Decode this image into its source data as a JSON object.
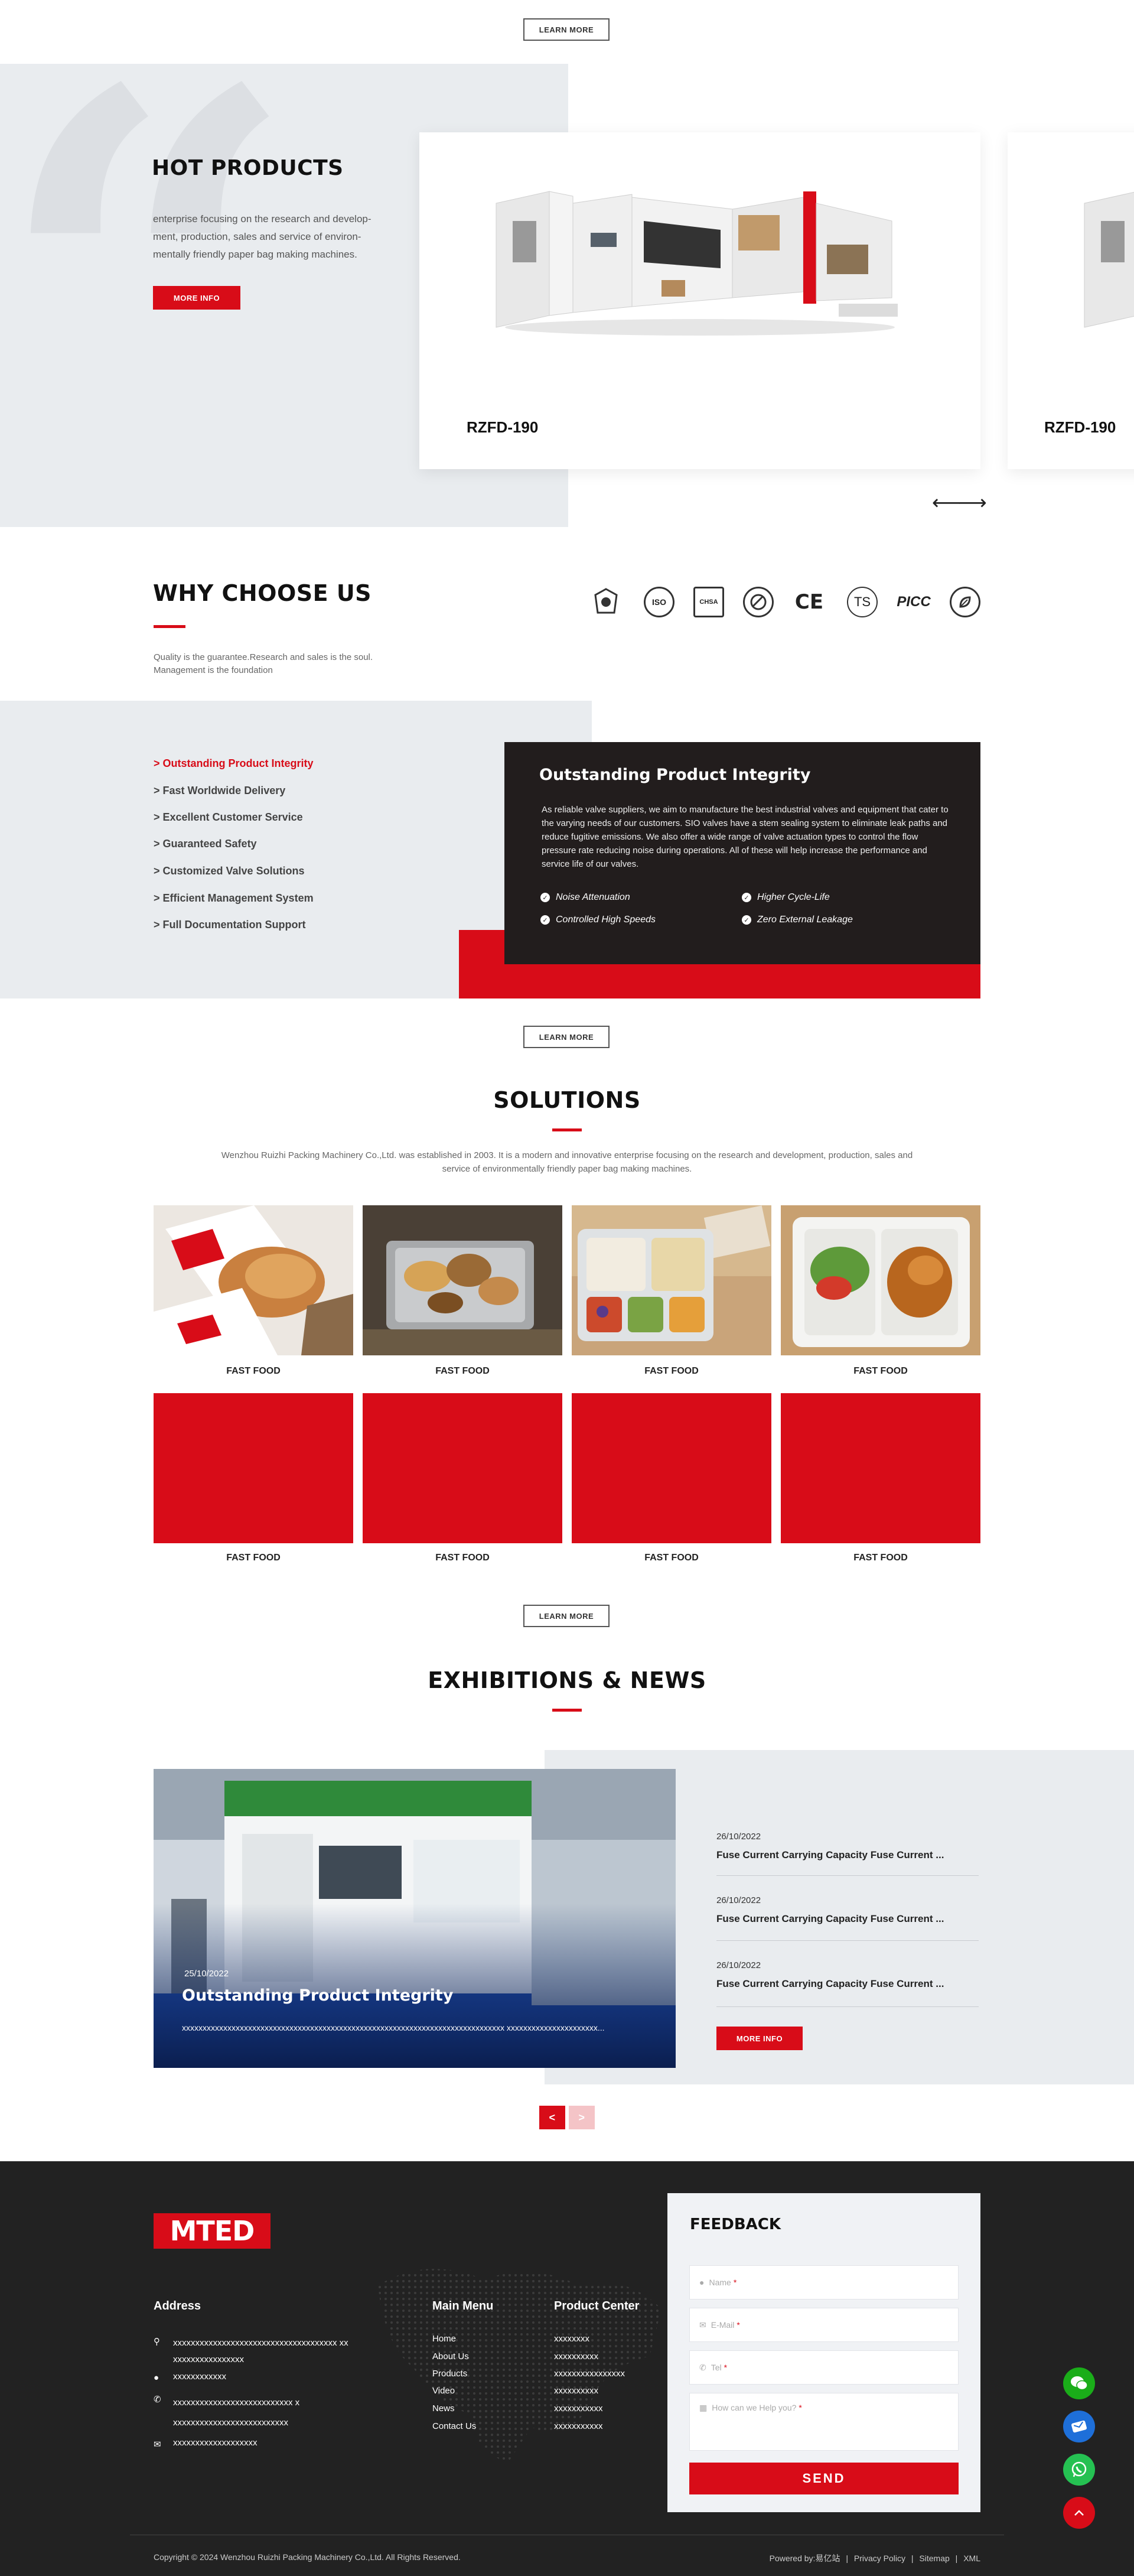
{
  "top": {
    "learn_more": "LEARN MORE"
  },
  "hot_products": {
    "title": "HOT PRODUCTS",
    "description": "enterprise focusing on the research and develop-ment, production, sales and service of environ-mentally friendly paper bag making machines.",
    "button": "MORE INFO",
    "products": [
      {
        "name": "RZFD-190"
      },
      {
        "name": "RZFD-190"
      }
    ],
    "prev_arrow": "⟵",
    "next_arrow": "⟶"
  },
  "why": {
    "title": "WHY CHOOSE US",
    "subtitle": "Quality is the guarantee.Research and sales is the soul. Management is the foundation",
    "certs": [
      "ISO",
      "CHSA",
      "CE",
      "TS",
      "PICC"
    ],
    "items": [
      "> Outstanding Product Integrity",
      "> Fast Worldwide Delivery",
      "> Excellent Customer Service",
      "> Guaranteed Safety",
      "> Customized Valve Solutions",
      "> Efficient Management System",
      "> Full Documentation Support"
    ],
    "panel": {
      "title": "Outstanding Product Integrity",
      "text": "As reliable valve suppliers, we aim to manufacture the best industrial valves and equipment that cater to the varying needs of our customers. SIO valves have a stem sealing system to eliminate leak paths and reduce fugitive emissions. We also offer a wide range of valve actuation types to control the flow pressure rate reducing noise during operations. All of these will help increase the performance and service life of our valves.",
      "features": [
        "Noise Attenuation",
        "Higher Cycle-Life",
        "Controlled High Speeds",
        "Zero External Leakage"
      ]
    },
    "learn_more": "LEARN MORE"
  },
  "solutions": {
    "title": "SOLUTIONS",
    "description": "Wenzhou Ruizhi Packing Machinery Co.,Ltd. was established in 2003. It is a modern and innovative enterprise focusing on the research and development, production, sales and service of environmentally friendly paper bag making machines.",
    "items": [
      "FAST FOOD",
      "FAST FOOD",
      "FAST FOOD",
      "FAST FOOD",
      "FAST FOOD",
      "FAST FOOD",
      "FAST FOOD",
      "FAST FOOD"
    ],
    "learn_more": "LEARN MORE"
  },
  "news": {
    "title": "EXHIBITIONS & NEWS",
    "featured": {
      "date": "25/10/2022",
      "title": "Outstanding Product Integrity",
      "text": "xxxxxxxxxxxxxxxxxxxxxxxxxxxxxxxxxxxxxxxxxxxxxxxxxxxxxxxxxxxxxxxxxxxxxxxxxxxxxx xxxxxxxxxxxxxxxxxxxxxx..."
    },
    "list": [
      {
        "date": "26/10/2022",
        "title": "Fuse Current Carrying Capacity Fuse Current ..."
      },
      {
        "date": "26/10/2022",
        "title": "Fuse Current Carrying Capacity Fuse Current ..."
      },
      {
        "date": "26/10/2022",
        "title": "Fuse Current Carrying Capacity Fuse Current ..."
      }
    ],
    "button": "MORE INFO",
    "prev": "<",
    "next": ">"
  },
  "footer": {
    "logo": "MTED",
    "address_title": "Address",
    "address": [
      "xxxxxxxxxxxxxxxxxxxxxxxxxxxxxxxxxxxxx xxxxxxxxxxxxxxxxxx",
      "xxxxxxxxxxxx",
      "xxxxxxxxxxxxxxxxxxxxxxxxxxx xxxxxxxxxxxxxxxxxxxxxxxxxxx",
      "xxxxxxxxxxxxxxxxxxx"
    ],
    "menu_title": "Main Menu",
    "menu": [
      "Home",
      "About Us",
      "Products",
      "Video",
      "News",
      "Contact Us"
    ],
    "product_title": "Product Center",
    "products": [
      "xxxxxxxx",
      "xxxxxxxxxx",
      "xxxxxxxxxxxxxxxx",
      "xxxxxxxxxx",
      "xxxxxxxxxxx",
      "xxxxxxxxxxx"
    ],
    "feedback": {
      "title": "FEEDBACK",
      "name_placeholder": "Name",
      "email_placeholder": "E-Mail",
      "tel_placeholder": "Tel",
      "message_placeholder": "How can we Help you?",
      "required": "*",
      "send": "SEND"
    },
    "copyright": "Copyright © 2024 Wenzhou Ruizhi Packing Machinery Co.,Ltd. All Rights Reserved.",
    "powered": "Powered by:易亿站",
    "links": [
      "Privacy Policy",
      "Sitemap",
      "XML"
    ],
    "separator": "|"
  },
  "colors": {
    "accent": "#d80c18",
    "dark_panel": "#221d1d",
    "footer_bg": "#222222",
    "light_bg": "#e9ecef"
  },
  "side_icons": [
    "wechat-icon",
    "message-icon",
    "whatsapp-icon",
    "back-to-top-icon"
  ]
}
